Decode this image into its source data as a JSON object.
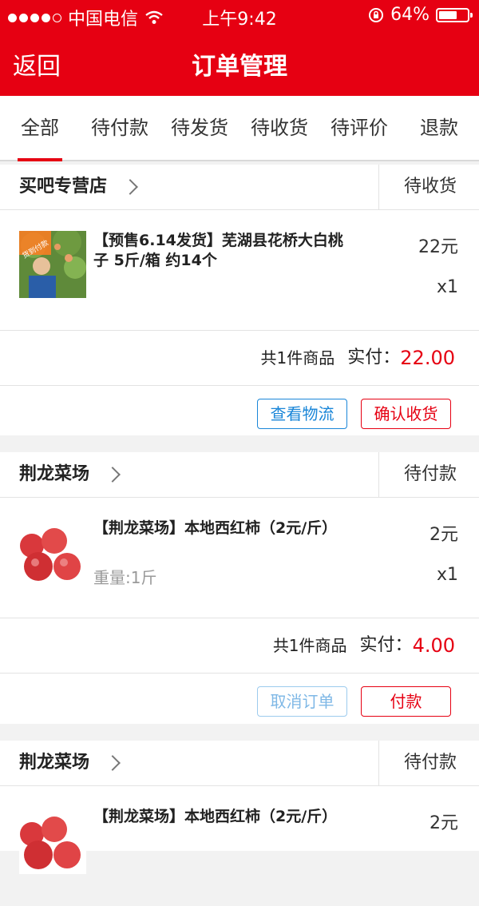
{
  "status_bar": {
    "carrier": "中国电信",
    "time": "上午9:42",
    "battery": "64%",
    "battery_level": 0.64,
    "signal_dots": 5,
    "signal_filled": 4,
    "icons": [
      "signal-dots-icon",
      "wifi-icon",
      "rotation-lock-icon",
      "battery-icon"
    ]
  },
  "nav": {
    "back_label": "返回",
    "title": "订单管理",
    "bg_color": "#e60012"
  },
  "tabs": [
    {
      "label": "全部",
      "active": true
    },
    {
      "label": "待付款"
    },
    {
      "label": "待发货"
    },
    {
      "label": "待收货"
    },
    {
      "label": "待评价"
    },
    {
      "label": "退款"
    }
  ],
  "orders": [
    {
      "store": "买吧专营店",
      "status": "待收货",
      "item": {
        "title": "【预售6.14发货】芜湖县花桥大白桃子 5斤/箱 约14个",
        "spec": "",
        "price": "22元",
        "qty": "x1",
        "thumb_badge": "货到付款"
      },
      "summary": {
        "count_text": "共1件商品",
        "pay_label": "实付：",
        "amount": "22.00"
      },
      "buttons": [
        "查看物流",
        "确认收货"
      ]
    },
    {
      "store": "荆龙菜场",
      "status": "待付款",
      "item": {
        "title": "【荆龙菜场】本地西红柿（2元/斤）",
        "spec": "重量:1斤",
        "price": "2元",
        "qty": "x1"
      },
      "summary": {
        "count_text": "共1件商品",
        "pay_label": "实付：",
        "amount": "4.00"
      },
      "buttons": [
        "取消订单",
        "付款"
      ]
    },
    {
      "store": "荆龙菜场",
      "status": "待付款",
      "item": {
        "title": "【荆龙菜场】本地西红柿（2元/斤）",
        "price": "2元"
      }
    }
  ],
  "colors": {
    "accent": "#e60012",
    "link_blue": "#1a86d8",
    "price_red": "#e60012"
  }
}
